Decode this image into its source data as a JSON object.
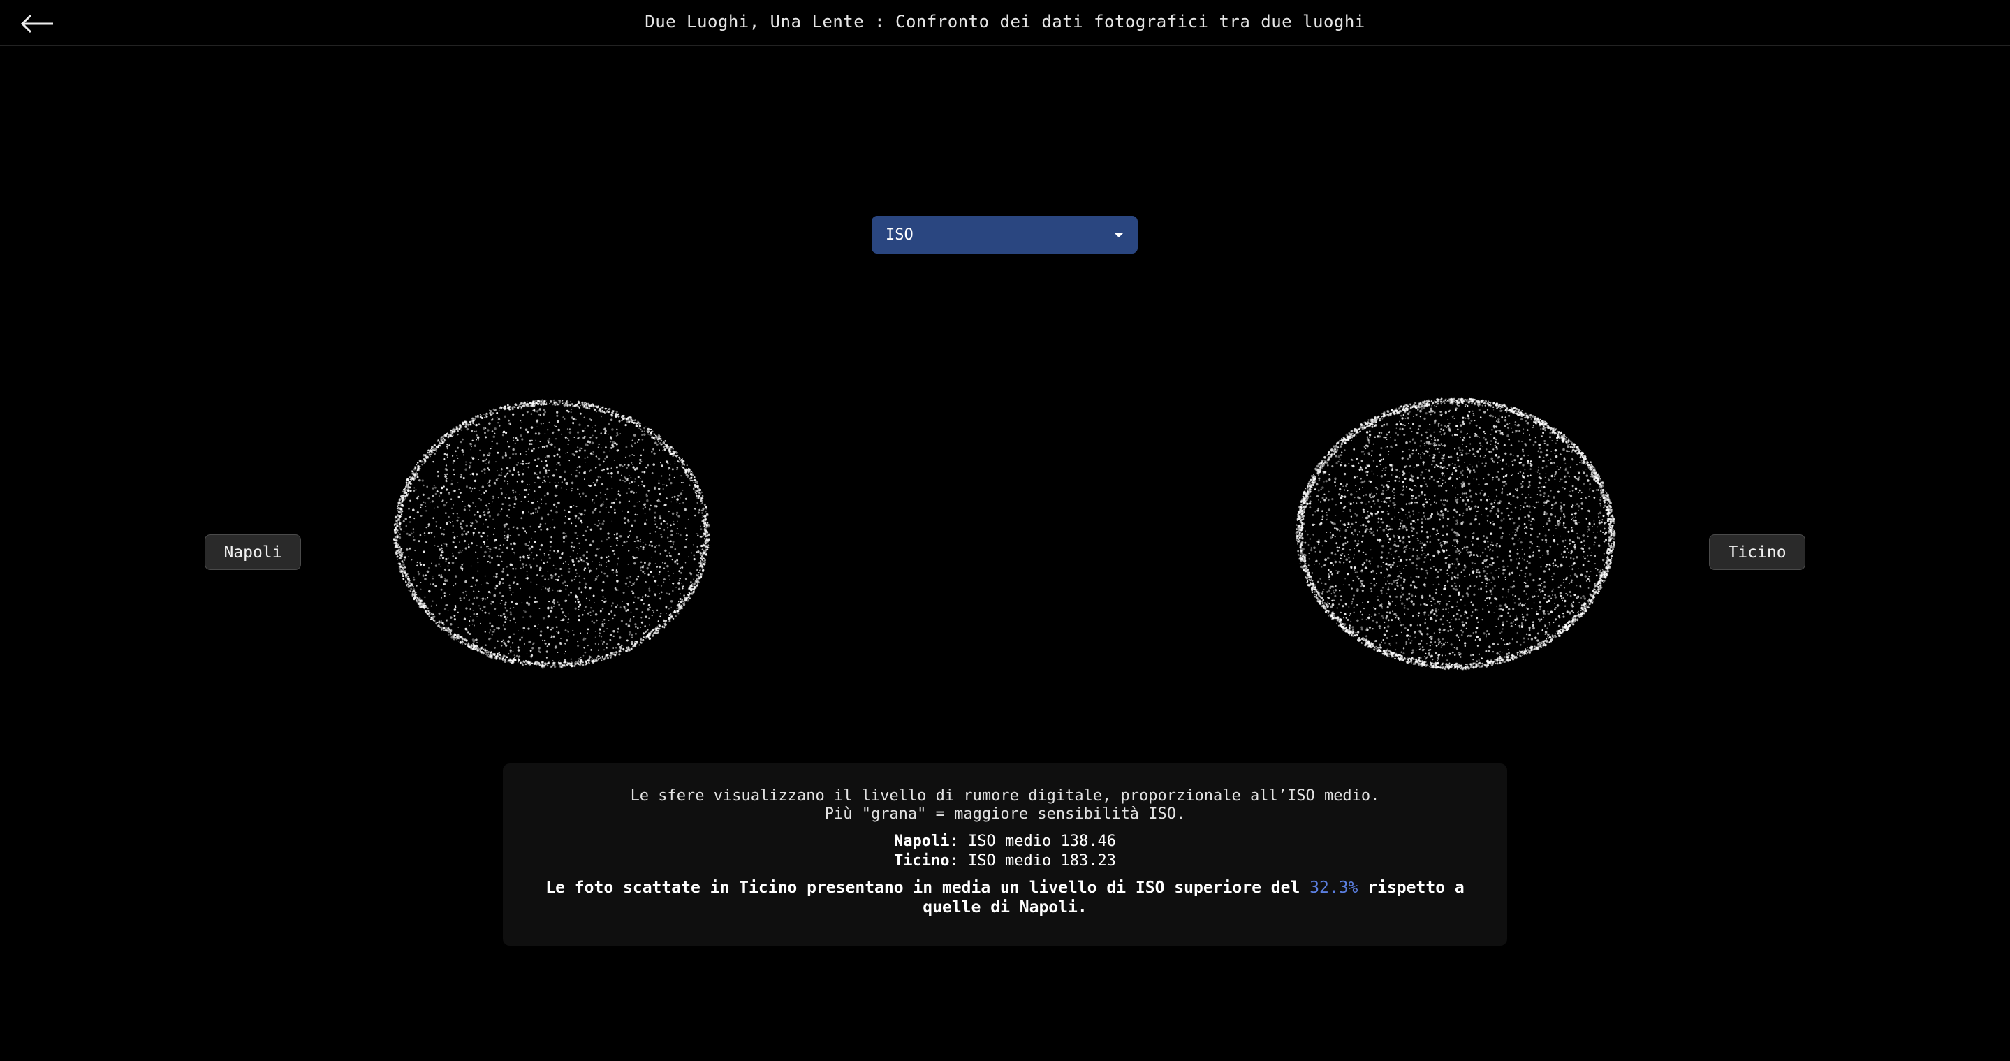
{
  "header": {
    "title": "Due Luoghi, Una Lente : Confronto dei dati fotografici tra due luoghi"
  },
  "metric_select": {
    "selected": "ISO"
  },
  "places": {
    "left": "Napoli",
    "right": "Ticino"
  },
  "info": {
    "line1": "Le sfere visualizzano il livello di rumore digitale, proporzionale all’ISO medio.",
    "line2": "Più \"grana\" = maggiore sensibilità ISO.",
    "napoli_label": "Napoli",
    "napoli_value": ": ISO medio 138.46",
    "ticino_label": "Ticino",
    "ticino_value": ": ISO medio 183.23",
    "conclusion_pre": "Le foto scattate in Ticino presentano in media un livello di ISO superiore del ",
    "conclusion_pct": "32.3%",
    "conclusion_post": " rispetto a quelle di Napoli."
  },
  "colors": {
    "background": "#000000",
    "select_bg": "#2a4680",
    "accent": "#5b7fe0",
    "particle": "#ffffff"
  },
  "icons": {
    "back": "arrow-left-icon",
    "dropdown": "caret-down-icon"
  }
}
